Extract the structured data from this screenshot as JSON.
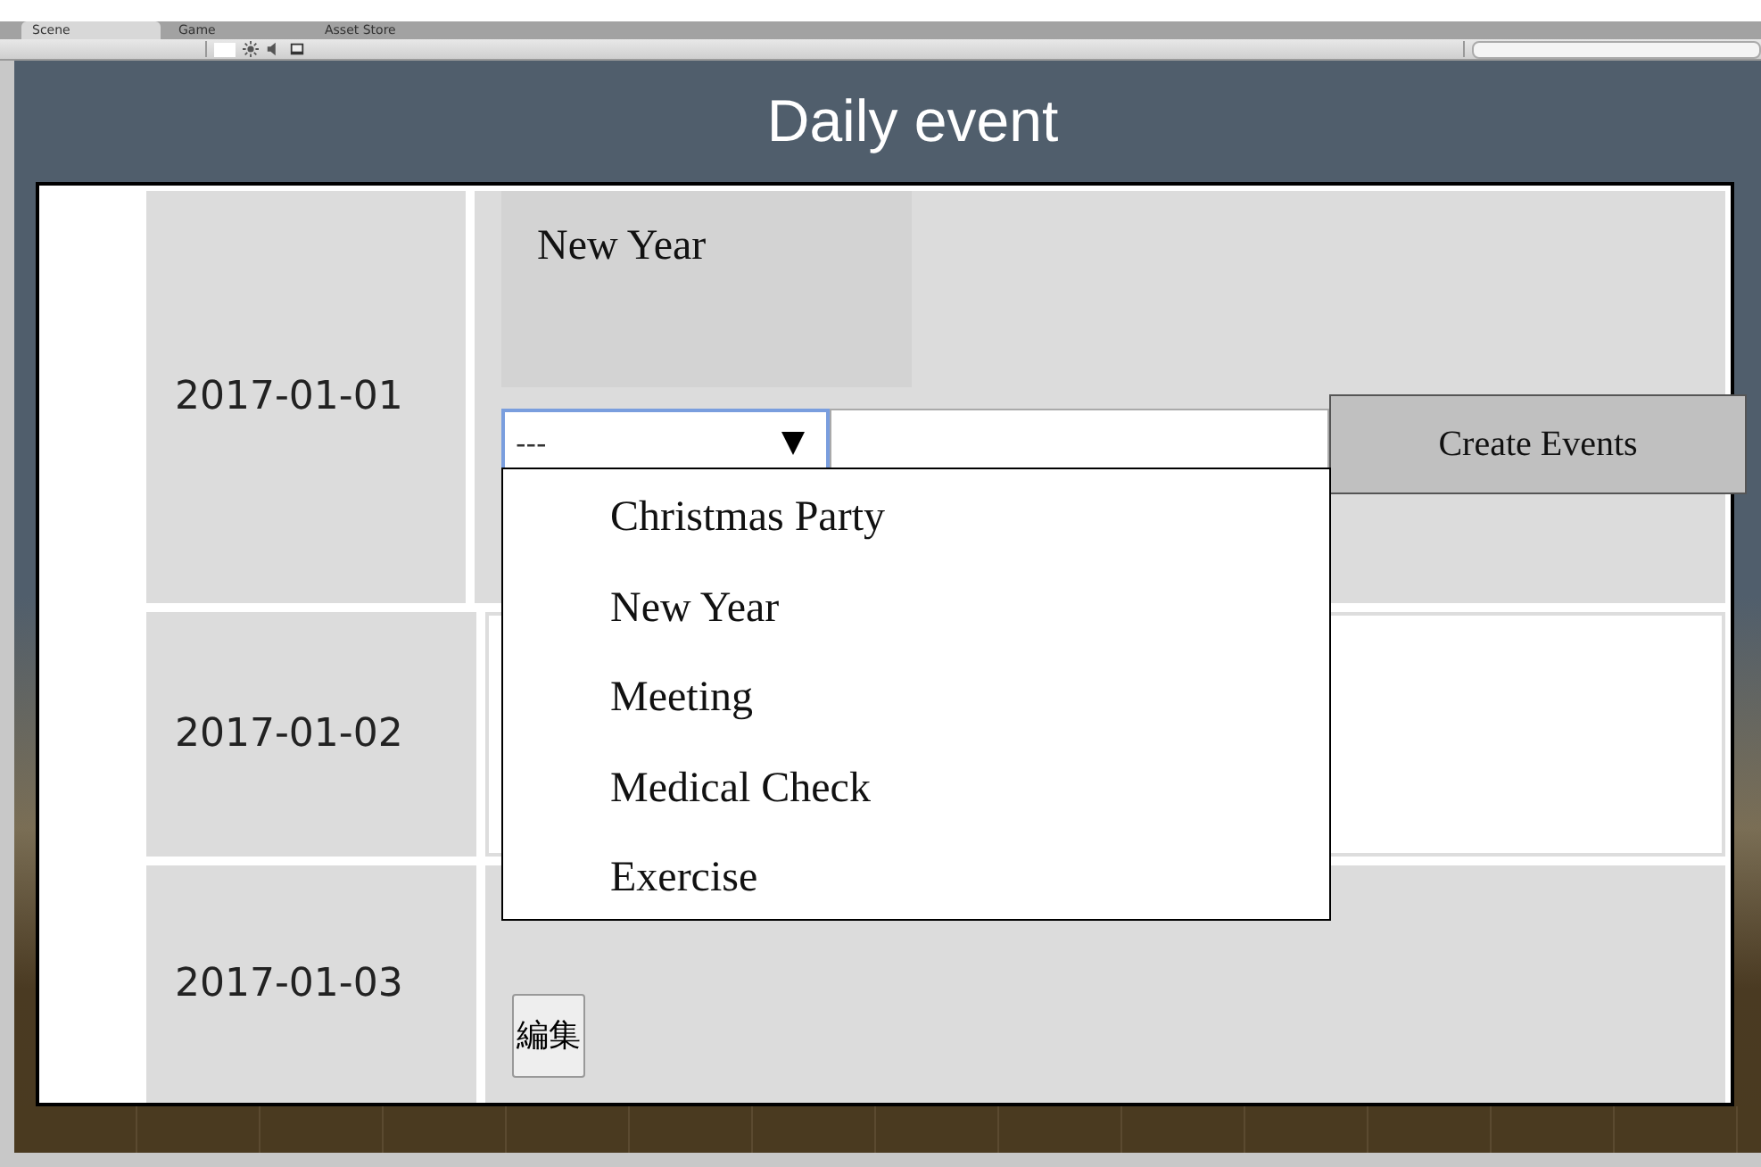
{
  "editor": {
    "tabs": [
      {
        "label": "Scene",
        "selected": true
      },
      {
        "label": "Game",
        "selected": false
      },
      {
        "label": "Asset Store",
        "selected": false
      }
    ]
  },
  "header": {
    "title": "Daily event"
  },
  "days": [
    {
      "kind": "form",
      "date": "2017-01-01",
      "event": "New Year",
      "select_value": "---",
      "button": "Create Events",
      "expanded": true,
      "options": [
        "Christmas Party",
        "New Year",
        "Meeting",
        "Medical Check",
        "Exercise"
      ]
    },
    {
      "kind": "empty",
      "date": "2017-01-02"
    },
    {
      "kind": "edit",
      "date": "2017-01-03",
      "edit_button": "編集"
    }
  ]
}
